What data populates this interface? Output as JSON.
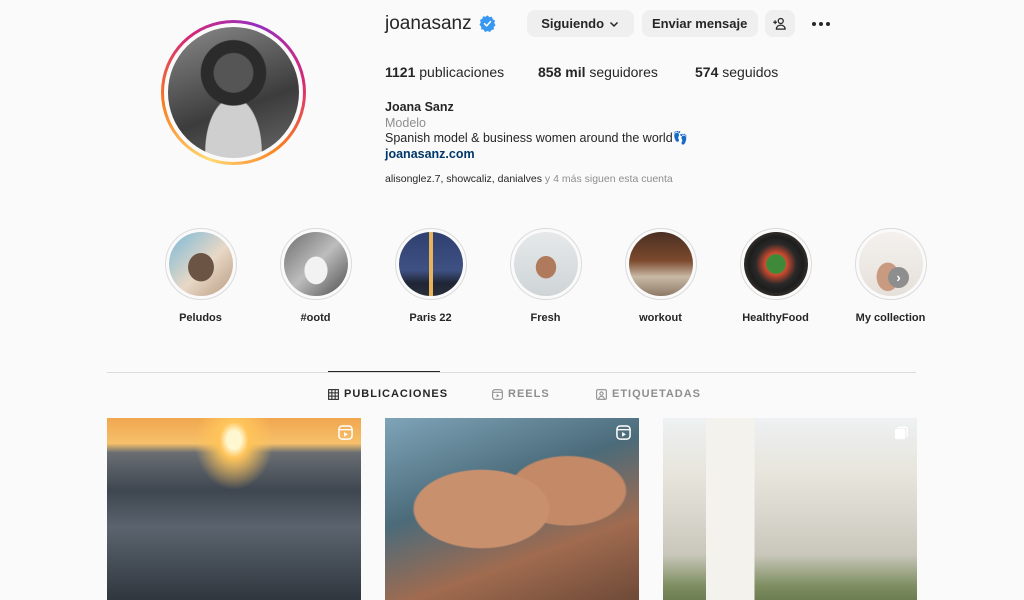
{
  "profile": {
    "username": "joanasanz",
    "verified_icon": "verified-badge-icon",
    "follow_button": "Siguiendo",
    "message_button": "Enviar mensaje",
    "add_user_icon": "add-user-icon",
    "more_icon": "more-options-icon",
    "stats": {
      "posts_count": "1121",
      "posts_label": "publicaciones",
      "followers_count": "858 mil",
      "followers_label": "seguidores",
      "following_count": "574",
      "following_label": "seguidos"
    },
    "full_name": "Joana Sanz",
    "category": "Modelo",
    "bio": "Spanish model & business women around the world👣",
    "website": "joanasanz.com",
    "followed_by": {
      "names": "alisonglez.7, showcaliz, danialves",
      "suffix": " y 4 más siguen esta cuenta"
    }
  },
  "highlights": [
    {
      "label": "Peludos"
    },
    {
      "label": "#ootd"
    },
    {
      "label": "Paris 22"
    },
    {
      "label": "Fresh"
    },
    {
      "label": "workout"
    },
    {
      "label": "HealthyFood"
    },
    {
      "label": "My collection"
    }
  ],
  "highlights_next_icon": "chevron-right-icon",
  "tabs": [
    {
      "label": "PUBLICACIONES",
      "icon": "grid-icon",
      "active": true
    },
    {
      "label": "REELS",
      "icon": "reels-icon",
      "active": false
    },
    {
      "label": "ETIQUETADAS",
      "icon": "tagged-icon",
      "active": false
    }
  ],
  "posts": [
    {
      "type": "reel",
      "icon": "reel-icon"
    },
    {
      "type": "reel",
      "icon": "reel-icon"
    },
    {
      "type": "carousel",
      "icon": "carousel-icon"
    }
  ],
  "colors": {
    "verified": "#3897f0",
    "link": "#00376b",
    "muted": "#8e8e8e",
    "button_bg": "#efefef"
  }
}
